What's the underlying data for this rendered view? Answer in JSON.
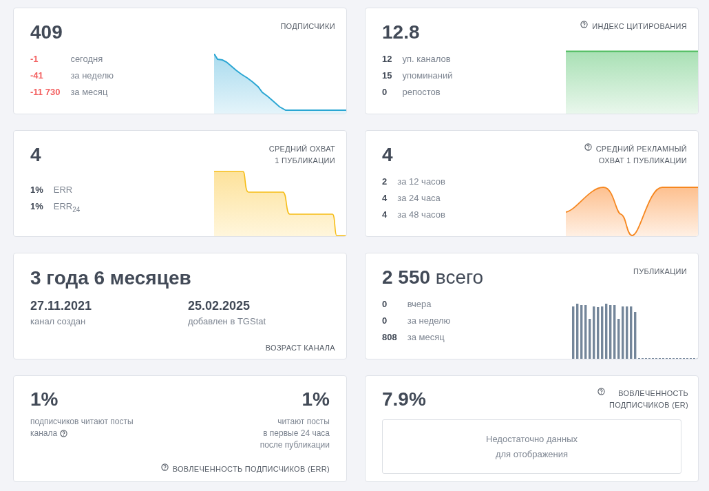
{
  "cards": [
    {
      "kind": "stats",
      "value": "409",
      "title": "ПОДПИСЧИКИ",
      "help_icon": false,
      "sparkline": {
        "kind": "decline"
      },
      "stats": [
        {
          "value": "-1",
          "label": "сегодня",
          "negative": true
        },
        {
          "value": "-41",
          "label": "за неделю",
          "negative": true
        },
        {
          "value": "-11 730",
          "label": "за месяц",
          "negative": true
        }
      ]
    },
    {
      "kind": "stats",
      "value": "12.8",
      "title": "ИНДЕКС ЦИТИРОВАНИЯ",
      "help_icon": true,
      "sparkline": {
        "kind": "flat"
      },
      "stats": [
        {
          "value": "12",
          "label": "уп. каналов",
          "negative": false
        },
        {
          "value": "15",
          "label": "упоминаний",
          "negative": false
        },
        {
          "value": "0",
          "label": "репостов",
          "negative": false
        }
      ]
    },
    {
      "kind": "stats",
      "value": "4",
      "title": "СРЕДНИЙ ОХВАТ\n1 ПУБЛИКАЦИИ",
      "help_icon": false,
      "sparkline": {
        "kind": "steps"
      },
      "stats": [
        {
          "value": "1%",
          "label": "ERR",
          "negative": false
        },
        {
          "value": "1%",
          "label": "ERR$_{24}$",
          "negative": false
        }
      ]
    },
    {
      "kind": "stats",
      "value": "4",
      "title": "СРЕДНИЙ РЕКЛАМНЫЙ\nОХВАТ 1 ПУБЛИКАЦИИ",
      "help_icon": true,
      "sparkline": {
        "kind": "wave"
      },
      "stats": [
        {
          "value": "2",
          "label": "за 12 часов",
          "negative": false
        },
        {
          "value": "4",
          "label": "за 24 часа",
          "negative": false
        },
        {
          "value": "4",
          "label": "за 48 часов",
          "negative": false
        }
      ]
    },
    {
      "kind": "age",
      "value": "3 года 6 месяцев",
      "dates": [
        {
          "date": "27.11.2021",
          "caption": "канал создан"
        },
        {
          "date": "25.02.2025",
          "caption": "добавлен в TGStat"
        }
      ],
      "footer": "ВОЗРАСТ КАНАЛА"
    },
    {
      "kind": "stats",
      "value": "**2 550** всего",
      "title": "ПУБЛИКАЦИИ",
      "help_icon": false,
      "sparkline": {
        "kind": "bars"
      },
      "stats": [
        {
          "value": "0",
          "label": "вчера",
          "negative": false
        },
        {
          "value": "0",
          "label": "за неделю",
          "negative": false
        },
        {
          "value": "808",
          "label": "за месяц",
          "negative": false
        }
      ]
    },
    {
      "kind": "err",
      "left": {
        "value": "1%",
        "caption_lines": [
          "подписчиков читают посты",
          "канала"
        ],
        "help_icon": true
      },
      "right": {
        "value": "1%",
        "caption": "читают посты\nв первые 24 часа\nпосле публикации"
      },
      "footer": "ВОВЛЕЧЕННОСТЬ ПОДПИСЧИКОВ (ERR)",
      "footer_help_icon": true
    },
    {
      "kind": "notice",
      "value": "7.9%",
      "title": "ВОВЛЕЧЕННОСТЬ\nПОДПИСЧИКОВ (ER)",
      "help_icon": true,
      "message": "Недостаточно данных\nдля отображения"
    }
  ]
}
